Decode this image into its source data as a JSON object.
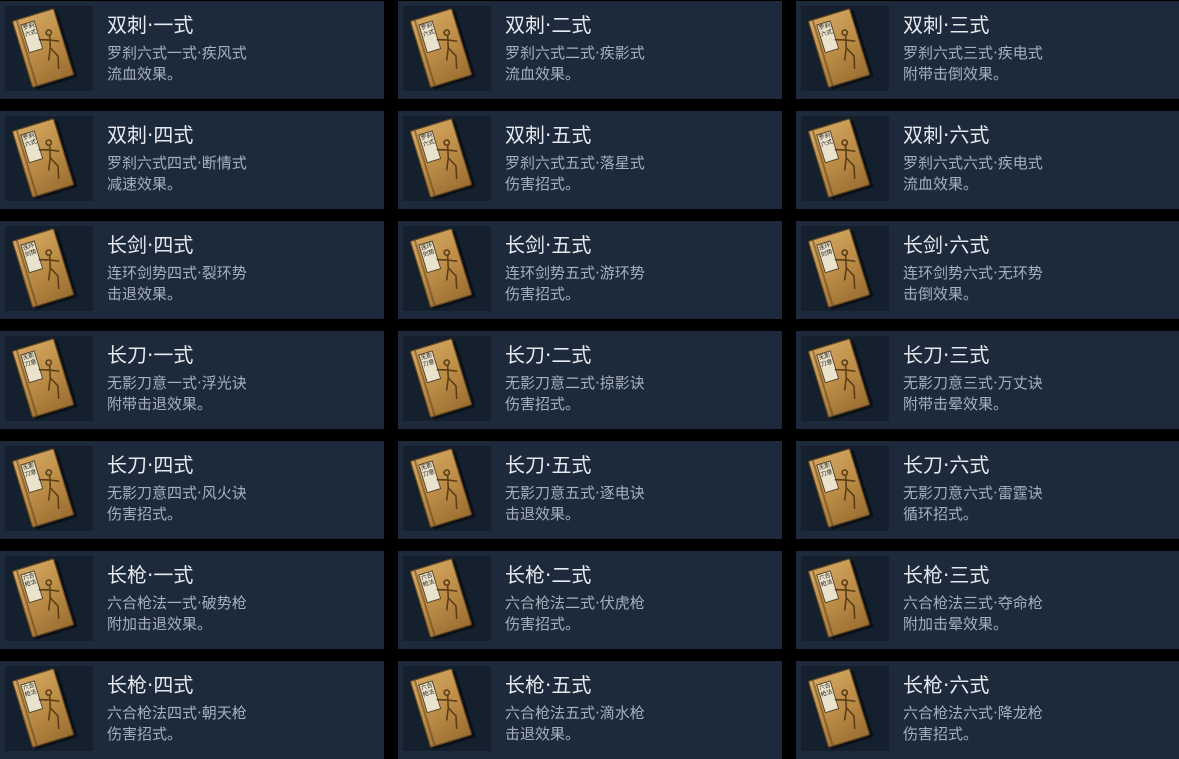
{
  "skills": [
    {
      "title": "双刺·一式",
      "line1": "罗刹六式一式·疾风式",
      "line2": "流血效果。",
      "book_label": "罗刹六式"
    },
    {
      "title": "双刺·二式",
      "line1": "罗刹六式二式·疾影式",
      "line2": "流血效果。",
      "book_label": "罗刹六式"
    },
    {
      "title": "双刺·三式",
      "line1": "罗刹六式三式·疾电式",
      "line2": "附带击倒效果。",
      "book_label": "罗刹六式"
    },
    {
      "title": "双刺·四式",
      "line1": "罗刹六式四式·断情式",
      "line2": "减速效果。",
      "book_label": "罗刹六式"
    },
    {
      "title": "双刺·五式",
      "line1": "罗刹六式五式·落星式",
      "line2": "伤害招式。",
      "book_label": "罗刹六式"
    },
    {
      "title": "双刺·六式",
      "line1": "罗刹六式六式·疾电式",
      "line2": "流血效果。",
      "book_label": "罗刹六式"
    },
    {
      "title": "长剑·四式",
      "line1": "连环剑势四式·裂环势",
      "line2": "击退效果。",
      "book_label": "连环剑势"
    },
    {
      "title": "长剑·五式",
      "line1": "连环剑势五式·游环势",
      "line2": "伤害招式。",
      "book_label": "连环剑势"
    },
    {
      "title": "长剑·六式",
      "line1": "连环剑势六式·无环势",
      "line2": "击倒效果。",
      "book_label": "连环剑势"
    },
    {
      "title": "长刀·一式",
      "line1": "无影刀意一式·浮光诀",
      "line2": "附带击退效果。",
      "book_label": "无影刀意"
    },
    {
      "title": "长刀·二式",
      "line1": "无影刀意二式·掠影诀",
      "line2": "伤害招式。",
      "book_label": "无影刀意"
    },
    {
      "title": "长刀·三式",
      "line1": "无影刀意三式·万丈诀",
      "line2": "附带击晕效果。",
      "book_label": "无影刀意"
    },
    {
      "title": "长刀·四式",
      "line1": "无影刀意四式·风火诀",
      "line2": "伤害招式。",
      "book_label": "无影刀意"
    },
    {
      "title": "长刀·五式",
      "line1": "无影刀意五式·逐电诀",
      "line2": "击退效果。",
      "book_label": "无影刀意"
    },
    {
      "title": "长刀·六式",
      "line1": "无影刀意六式·雷霆诀",
      "line2": "循环招式。",
      "book_label": "无影刀意"
    },
    {
      "title": "长枪·一式",
      "line1": "六合枪法一式·破势枪",
      "line2": "附加击退效果。",
      "book_label": "六合枪法"
    },
    {
      "title": "长枪·二式",
      "line1": "六合枪法二式·伏虎枪",
      "line2": "伤害招式。",
      "book_label": "六合枪法"
    },
    {
      "title": "长枪·三式",
      "line1": "六合枪法三式·夺命枪",
      "line2": "附加击晕效果。",
      "book_label": "六合枪法"
    },
    {
      "title": "长枪·四式",
      "line1": "六合枪法四式·朝天枪",
      "line2": "伤害招式。",
      "book_label": "六合枪法"
    },
    {
      "title": "长枪·五式",
      "line1": "六合枪法五式·滴水枪",
      "line2": "击退效果。",
      "book_label": "六合枪法"
    },
    {
      "title": "长枪·六式",
      "line1": "六合枪法六式·降龙枪",
      "line2": "伤害招式。",
      "book_label": "六合枪法"
    }
  ],
  "icons": {
    "skill_book": "martial-arts-manual-icon"
  },
  "colors": {
    "card_bg": "#1c2a3b",
    "title": "#e6e9ee",
    "subtitle": "#a6b1bd"
  }
}
